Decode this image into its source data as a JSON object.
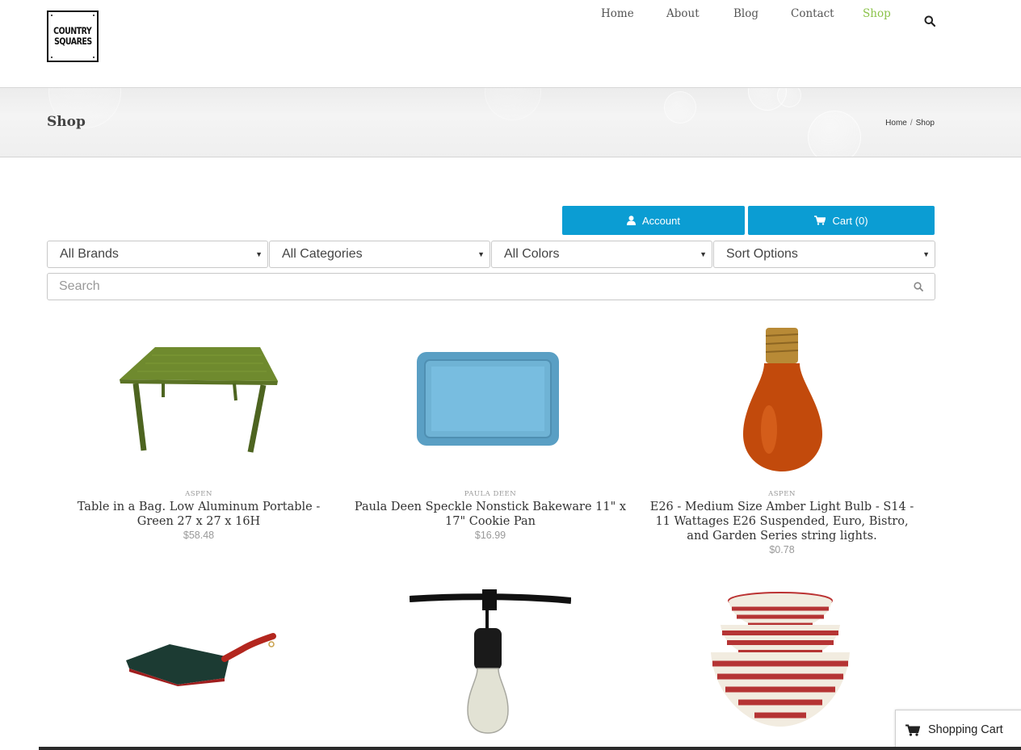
{
  "logo": {
    "line1": "COUNTRY",
    "line2": "SQUARES"
  },
  "nav": {
    "items": [
      "Home",
      "About",
      "Blog",
      "Contact",
      "Shop"
    ],
    "active": "Shop",
    "accent_color": "#8bc34a",
    "search_icon": "search-icon"
  },
  "titlebar": {
    "title": "Shop",
    "breadcrumb": [
      "Home",
      "Shop"
    ]
  },
  "buttons": {
    "account": {
      "label": "Account",
      "icon": "user-icon"
    },
    "cart": {
      "label": "Cart (0)",
      "icon": "cart-icon"
    },
    "color": "#0b9dd3"
  },
  "filters": {
    "brands": "All Brands",
    "categories": "All Categories",
    "colors": "All Colors",
    "sort": "Sort Options",
    "search_placeholder": "Search"
  },
  "products": [
    {
      "brand": "ASPEN",
      "name": "Table in a Bag. Low Aluminum Portable - Green 27 x 27 x 16H",
      "price": "$58.48"
    },
    {
      "brand": "PAULA DEEN",
      "name": "Paula Deen Speckle Nonstick Bakeware 11\" x 17\" Cookie Pan",
      "price": "$16.99"
    },
    {
      "brand": "ASPEN",
      "name": "E26 - Medium Size Amber Light Bulb - S14 - 11 Wattages E26 Suspended, Euro, Bistro, and Garden Series string lights.",
      "price": "$0.78"
    }
  ],
  "cart_widget": {
    "label": "Shopping Cart",
    "icon": "cart-icon"
  }
}
